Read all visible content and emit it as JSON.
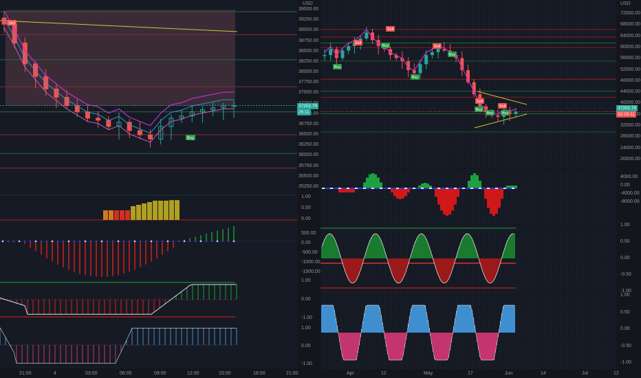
{
  "left": {
    "currency": "USD",
    "price_ticks": [
      "39500.00",
      "39250.00",
      "39000.00",
      "38750.00",
      "38500.00",
      "38250.00",
      "38000.00",
      "37750.00",
      "37500.00",
      "37250.00",
      "37000.00",
      "36750.00",
      "36500.00",
      "36250.00",
      "36000.00",
      "35750.00",
      "35500.00",
      "35250.00"
    ],
    "current_price": "37202.79",
    "countdown": "25:11",
    "time_ticks": [
      "21:00",
      "4",
      "03:00",
      "06:00",
      "09:00",
      "12:00",
      "15:00",
      "18:00",
      "21:00"
    ],
    "sell_label": "Sell",
    "buy_label": "Buy",
    "p1_ticks": [
      "1.00",
      "0.50",
      "0.00"
    ],
    "p2_ticks": [
      "500.00",
      "0.00",
      "-500.00",
      "-1000.00",
      "-1500.00"
    ],
    "p3_ticks": [
      "1.00",
      "0.00",
      "-1.00"
    ],
    "p4_ticks": [
      "1.00",
      "0.00",
      "-1.00"
    ]
  },
  "right": {
    "currency": "USD",
    "price_ticks": [
      "72000.00",
      "68000.00",
      "64000.00",
      "60000.00",
      "56000.00",
      "52000.00",
      "48000.00",
      "44000.00",
      "40000.00",
      "36000.00",
      "32000.00",
      "28000.00",
      "24000.00",
      "20000.00"
    ],
    "current_price": "37202.79",
    "countdown": "32:15:11",
    "time_ticks": [
      "Apr",
      "12",
      "May",
      "17",
      "Jun",
      "14",
      "Jul",
      "12"
    ],
    "sell_label": "Sell",
    "buy_label": "Buy",
    "p1_ticks": [
      "4000.00",
      "0.00",
      "-4000.00",
      "-8000.00"
    ],
    "p2_ticks": [
      "1.00",
      "0.50",
      "0.00",
      "-0.50",
      "-1.00"
    ],
    "p3_ticks": [
      "1.00",
      "0.50",
      "0.00",
      "-0.50",
      "-1.00"
    ]
  },
  "chart_data": [
    {
      "type": "candlestick",
      "title": "",
      "timeframe": "intraday",
      "y_axis_label": "USD",
      "ylim": [
        35250,
        39500
      ],
      "x_ticks": [
        "21:00",
        "4",
        "03:00",
        "06:00",
        "09:00",
        "12:00",
        "15:00",
        "18:00",
        "21:00"
      ],
      "close_approx": [
        39150,
        38700,
        38200,
        37900,
        37600,
        37400,
        37200,
        37050,
        36900,
        36850,
        36700,
        36800,
        36600,
        36500,
        36400,
        36700,
        36900,
        36950,
        37050,
        37100,
        37150,
        37200,
        37202.79
      ],
      "last_price": 37202.79,
      "signals": [
        {
          "type": "Sell",
          "near": "21:00"
        },
        {
          "type": "Buy",
          "near": "12:00"
        }
      ]
    },
    {
      "type": "candlestick",
      "title": "",
      "timeframe": "daily",
      "y_axis_label": "USD",
      "ylim": [
        20000,
        72000
      ],
      "x_ticks": [
        "Apr",
        "12",
        "May",
        "17",
        "Jun",
        "14",
        "Jul",
        "12"
      ],
      "close_approx": [
        56000,
        58000,
        55000,
        57500,
        59000,
        60000,
        61500,
        63500,
        61000,
        59000,
        58000,
        56000,
        55000,
        54000,
        51000,
        50000,
        53000,
        56000,
        57000,
        58000,
        57500,
        56000,
        55000,
        51000,
        47000,
        43000,
        39000,
        37000,
        36000,
        35500,
        37000,
        36500,
        37202.79
      ],
      "last_price": 37202.79,
      "signals": [
        {
          "type": "Sell"
        },
        {
          "type": "Buy"
        },
        {
          "type": "Sell"
        },
        {
          "type": "Buy"
        },
        {
          "type": "Sell"
        },
        {
          "type": "Sell"
        },
        {
          "type": "Buy"
        },
        {
          "type": "Sell"
        },
        {
          "type": "Buy"
        },
        {
          "type": "Buy"
        }
      ]
    }
  ],
  "colors": {
    "bull": "#26a69a",
    "bear": "#ef5350",
    "green": "#1e9e3a",
    "red": "#e0201c",
    "blue": "#3f8fd0",
    "pink": "#c4356f",
    "magenta": "#c030d0",
    "yellow": "#d9c23a"
  }
}
